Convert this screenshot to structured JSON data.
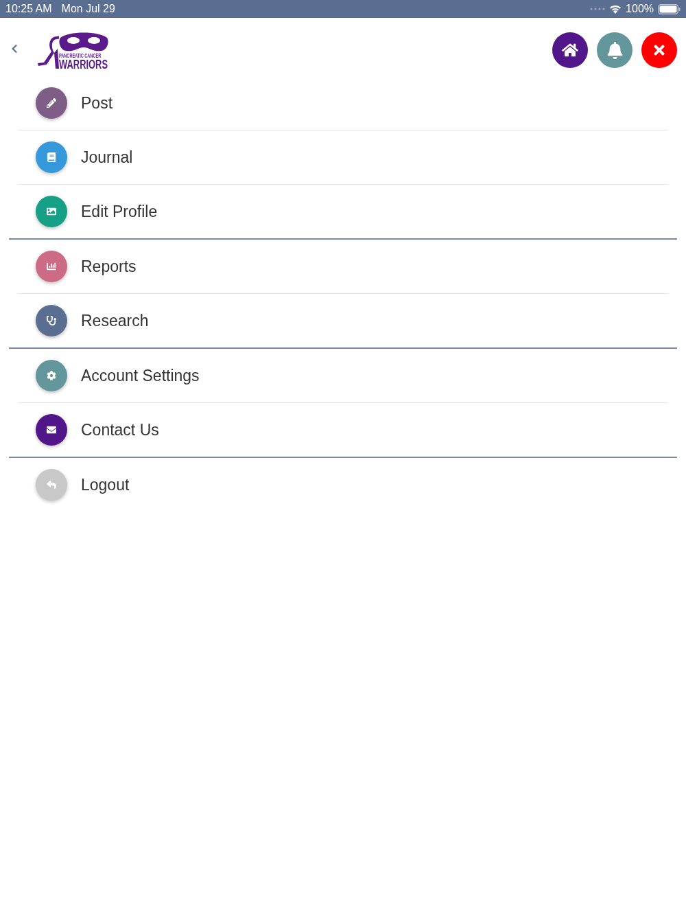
{
  "status_bar": {
    "time": "10:25 AM",
    "date": "Mon Jul 29",
    "battery": "100%"
  },
  "header": {
    "logo": {
      "line_1": "PANCREATIC CANCER",
      "line_2": "WARRIORS"
    },
    "buttons": [
      {
        "color": "#51168a"
      },
      {
        "color": "#62969a"
      },
      {
        "color": "#fe0000"
      }
    ]
  },
  "menu": {
    "groups": [
      {
        "items": [
          {
            "label": "Post",
            "color": "#7e5e87"
          },
          {
            "label": "Journal",
            "color": "#3498db"
          },
          {
            "label": "Edit Profile",
            "color": "#16a085"
          }
        ]
      },
      {
        "items": [
          {
            "label": "Reports",
            "color": "#cd6a85"
          },
          {
            "label": "Research",
            "color": "#5a6e91"
          }
        ]
      },
      {
        "items": [
          {
            "label": "Account Settings",
            "color": "#62969a"
          },
          {
            "label": "Contact Us",
            "color": "#51168a"
          }
        ]
      },
      {
        "items": [
          {
            "label": "Logout",
            "color": "#c8c8c8"
          }
        ]
      }
    ]
  }
}
